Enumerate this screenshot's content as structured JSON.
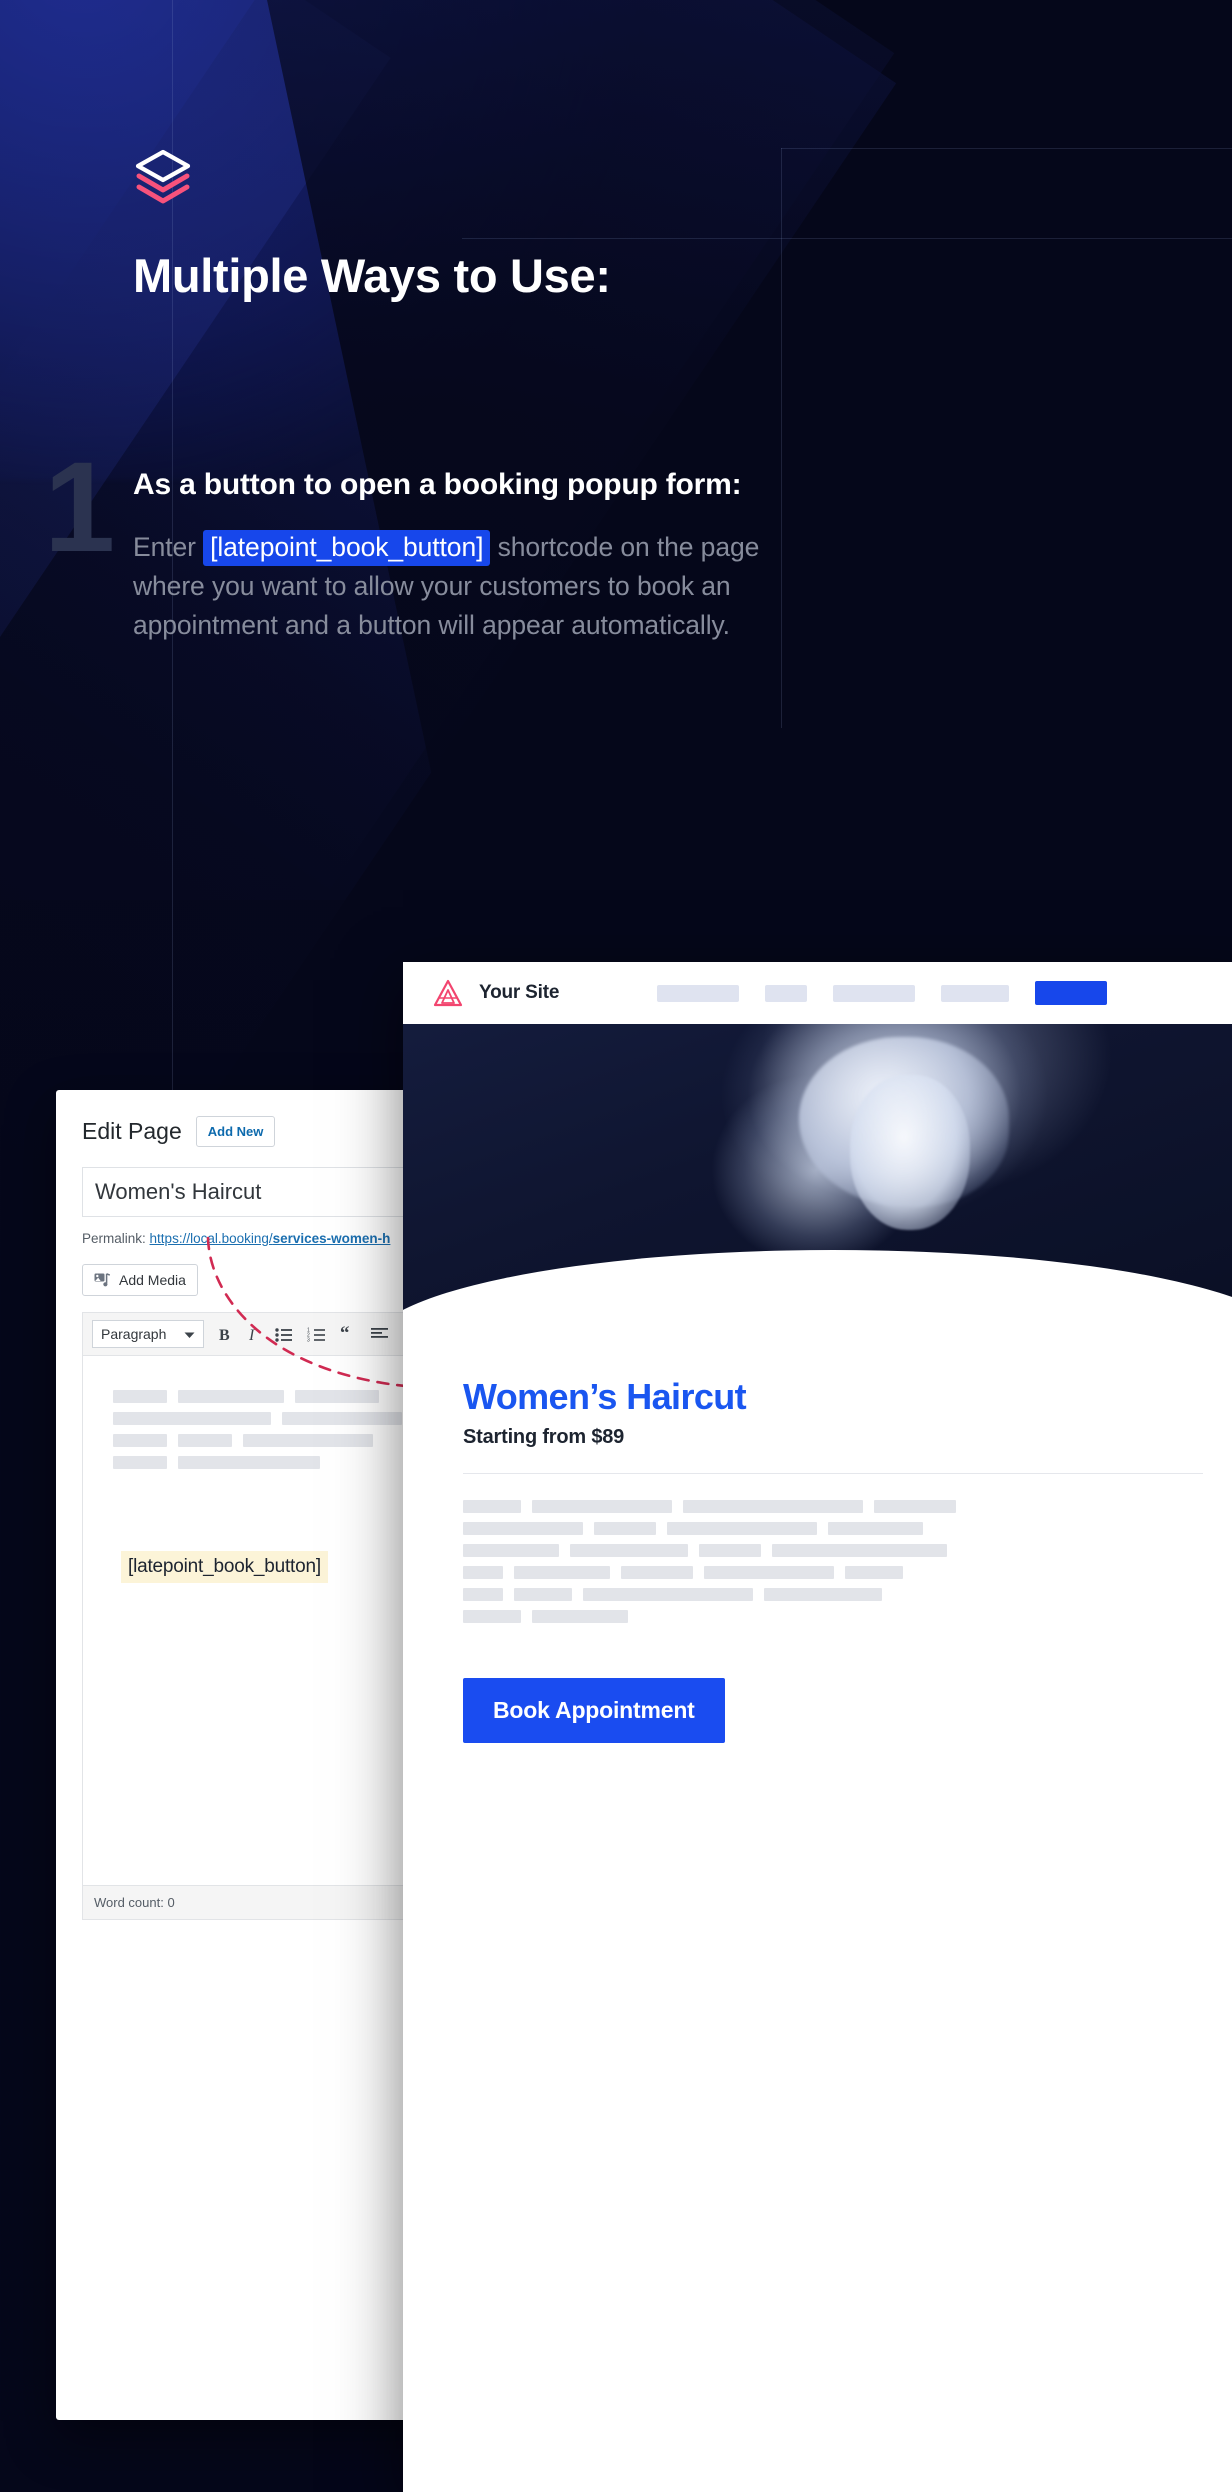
{
  "hero": {
    "logo_icon": "layers-stack-icon",
    "headline": "Multiple Ways to Use:"
  },
  "step": {
    "number": "1",
    "title": "As a button to open a booking popup form:",
    "body_prefix": "Enter ",
    "shortcode": "[latepoint_book_button]",
    "body_suffix": " shortcode on the page where you want to allow your customers to book an appointment and a button will appear automatically."
  },
  "wp_editor": {
    "heading": "Edit Page",
    "add_new_label": "Add New",
    "post_title": "Women's Haircut",
    "permalink_label": "Permalink:",
    "permalink_base": "https://local.booking/",
    "permalink_slug": "services-women-h",
    "add_media_label": "Add Media",
    "add_media_icon": "media-icon",
    "format_select": "Paragraph",
    "format_caret_icon": "chevron-down-icon",
    "toolbar_icons": [
      "bold-icon",
      "italic-icon",
      "bullet-list-icon",
      "numbered-list-icon",
      "blockquote-icon",
      "align-left-icon"
    ],
    "content_shortcode": "[latepoint_book_button]",
    "word_count": "Word count: 0"
  },
  "site_preview": {
    "logo_icon": "triangle-logo-icon",
    "site_name": "Your Site",
    "nav_items": [
      "",
      "",
      "",
      ""
    ],
    "nav_cta": "",
    "service_title": "Women’s Haircut",
    "service_price": "Starting from $89",
    "book_button": "Book Appointment"
  },
  "colors": {
    "page_bg": "#05071a",
    "accent_blue": "#1747eb",
    "accent_pink": "#f7527c",
    "body_text": "#878c9c",
    "shortcode_editor_bg": "#fcf4d8",
    "arrow": "#d12a52"
  }
}
